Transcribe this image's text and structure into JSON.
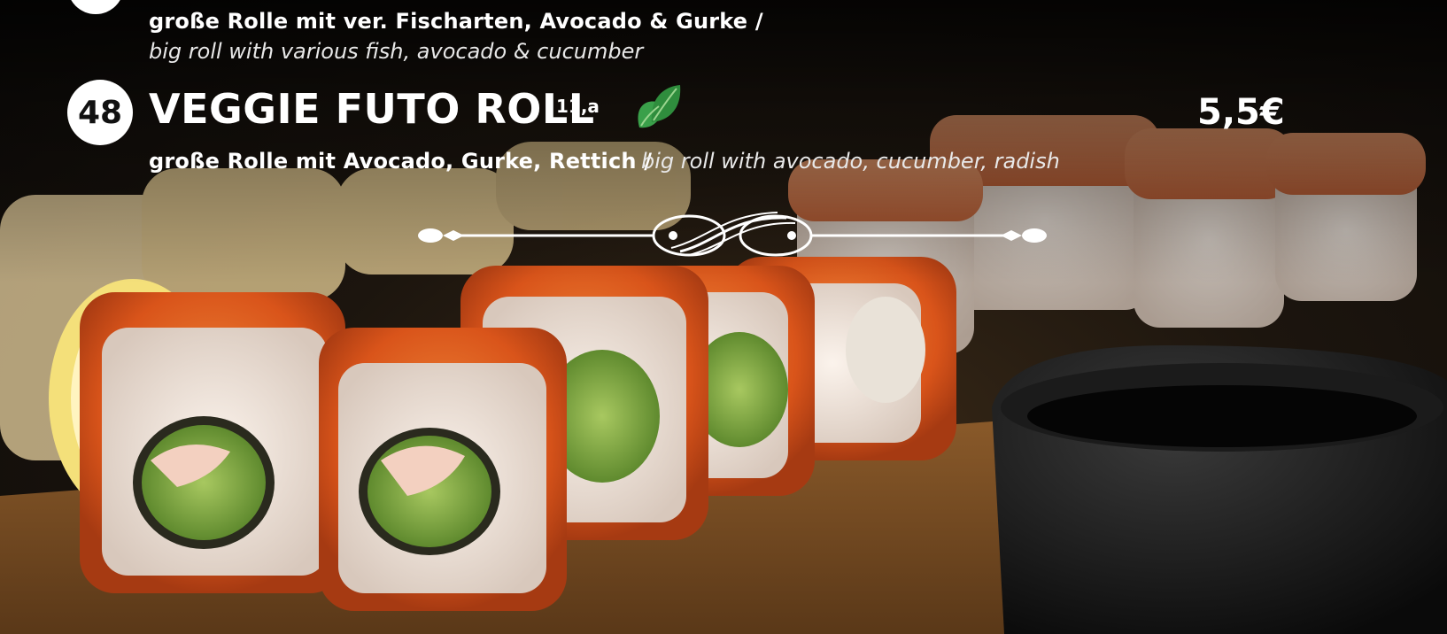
{
  "items": [
    {
      "number": "",
      "name": "",
      "allergens": "",
      "description_de": "große Rolle mit ver. Fischarten, Avocado & Gurke /",
      "description_en": "big roll with various fish, avocado & cucumber",
      "price": ""
    },
    {
      "number": "48",
      "name": "VEGGIE FUTO ROLL",
      "allergens": "11,a",
      "description_de": "große Rolle mit Avocado, Gurke, Rettich /",
      "description_en": "big roll with avocado, cucumber, radish",
      "price": "5,5€",
      "badge_icon": "leaf-icon",
      "badge_color": "#3aa04a"
    }
  ],
  "colors": {
    "text": "#ffffff",
    "number_circle": "#ffffff"
  }
}
